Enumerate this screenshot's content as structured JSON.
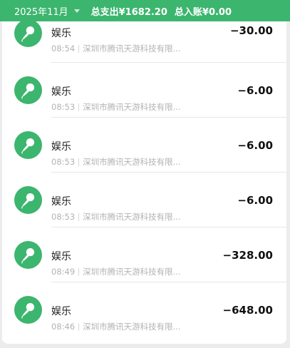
{
  "header": {
    "month": "2025年11月",
    "total_expense": "总支出¥1682.20",
    "total_income": "总入账¥0.00"
  },
  "colors": {
    "brand_green": "#3cb56e",
    "divider": "#e7e7e7",
    "muted_text": "#b3b3b3"
  },
  "transactions": [
    {
      "icon": "microphone-icon",
      "category": "娱乐",
      "time": "08:54",
      "merchant": "深圳市腾讯天游科技有限...",
      "amount": "−30.00"
    },
    {
      "icon": "microphone-icon",
      "category": "娱乐",
      "time": "08:53",
      "merchant": "深圳市腾讯天游科技有限...",
      "amount": "−6.00"
    },
    {
      "icon": "microphone-icon",
      "category": "娱乐",
      "time": "08:53",
      "merchant": "深圳市腾讯天游科技有限...",
      "amount": "−6.00"
    },
    {
      "icon": "microphone-icon",
      "category": "娱乐",
      "time": "08:53",
      "merchant": "深圳市腾讯天游科技有限...",
      "amount": "−6.00"
    },
    {
      "icon": "microphone-icon",
      "category": "娱乐",
      "time": "08:49",
      "merchant": "深圳市腾讯天游科技有限...",
      "amount": "−328.00"
    },
    {
      "icon": "microphone-icon",
      "category": "娱乐",
      "time": "08:46",
      "merchant": "深圳市腾讯天游科技有限...",
      "amount": "−648.00"
    }
  ]
}
